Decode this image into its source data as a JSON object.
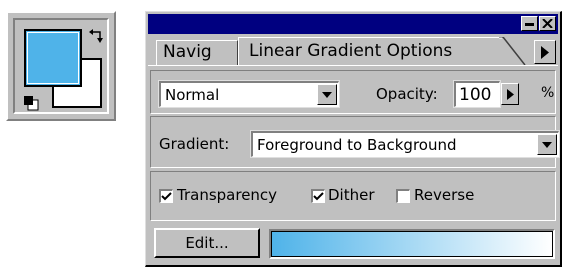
{
  "colors": {
    "foreground": "#4fb3e9",
    "background": "#ffffff",
    "title_bar": "#000080"
  },
  "icons": {
    "swap": "swap-arrows-icon",
    "default_colors": "default-colors-icon",
    "minimize": "minimize-icon",
    "close": "close-icon",
    "tab_scroll": "right-arrow-icon"
  },
  "tabs": [
    {
      "label": "Navig"
    },
    {
      "label": "Linear Gradient Options"
    }
  ],
  "options": {
    "blend_mode": "Normal",
    "opacity_label": "Opacity:",
    "opacity_value": "100",
    "percent": "%",
    "gradient_label": "Gradient:",
    "gradient_value": "Foreground to Background",
    "transparency_label": "Transparency",
    "transparency_checked": true,
    "dither_label": "Dither",
    "dither_checked": true,
    "reverse_label": "Reverse",
    "reverse_checked": false,
    "edit_label": "Edit..."
  }
}
